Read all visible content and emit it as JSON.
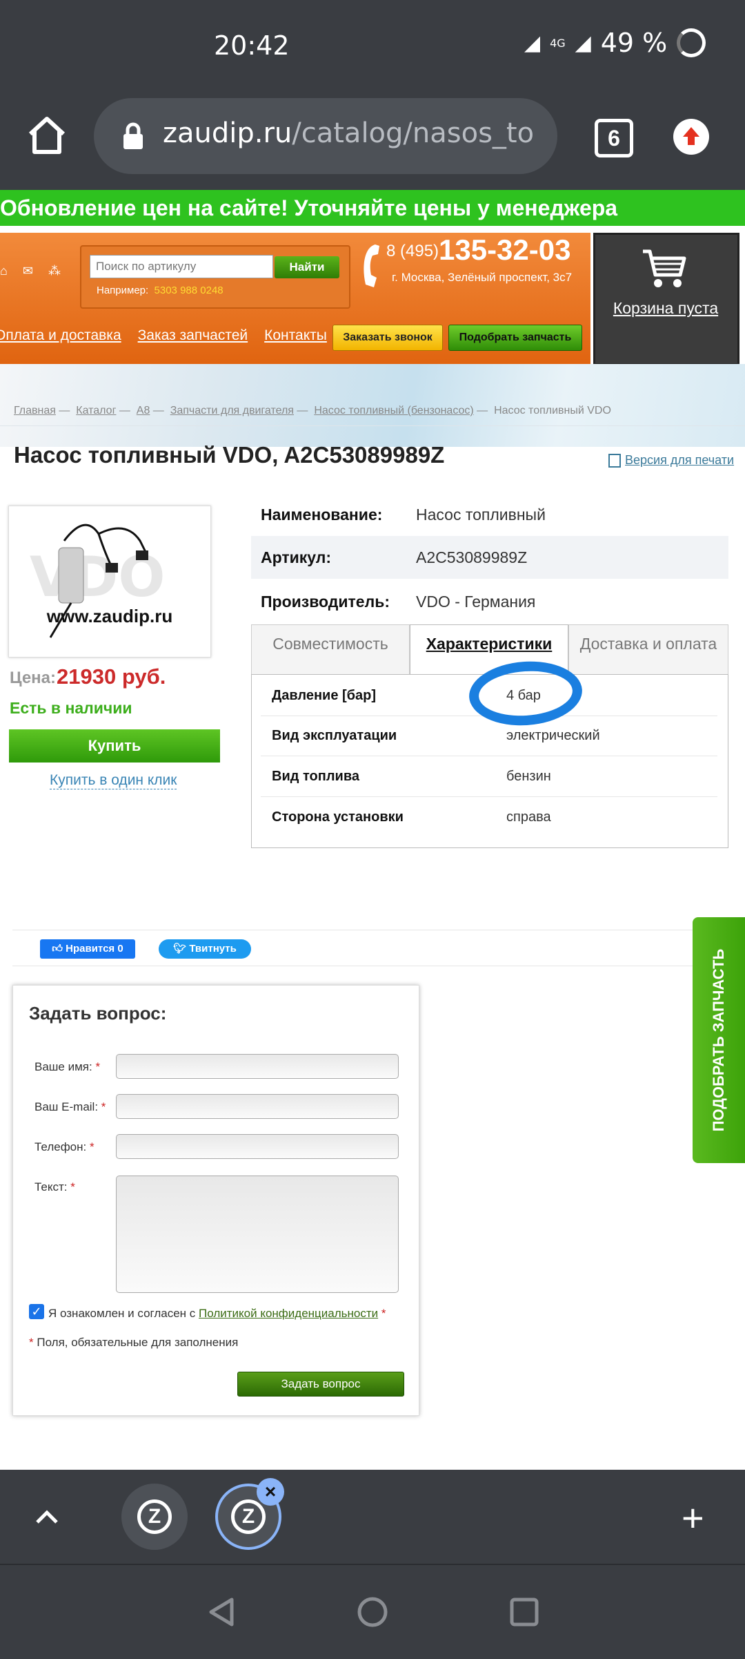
{
  "status": {
    "time": "20:42",
    "network": "4G",
    "battery": "49 %"
  },
  "browser": {
    "url_host": "zaudip.ru",
    "url_path": "/catalog/nasos_to",
    "tab_count": "6"
  },
  "banner": {
    "text": "Обновление цен на сайте! Уточняйте цены у менеджера"
  },
  "header": {
    "search_placeholder": "Поиск по артикулу",
    "search_button": "Найти",
    "example_label": "Например:",
    "example_code": "5303 988 0248",
    "phone_prefix": "8 (495)",
    "phone_number": "135-32-03",
    "address": "г. Москва, Зелёный проспект, 3с7",
    "nav": [
      "Оплата и доставка",
      "Заказ запчастей",
      "Контакты"
    ],
    "callback_button": "Заказать звонок",
    "pick_button": "Подобрать запчасть",
    "cart_label": "Корзина пуста"
  },
  "breadcrumb": [
    "Главная",
    "Каталог",
    "A8",
    "Запчасти для двигателя",
    "Насос топливный (бензонасос)",
    "Насос топливный VDO"
  ],
  "product": {
    "title": "Насос топливный VDO, A2C53089989Z",
    "print_link": "Версия для печати",
    "image_watermark": "www.zaudip.ru",
    "image_logo": "VDO",
    "price_label": "Цена:",
    "price": "21930 руб.",
    "stock": "Есть в наличии",
    "buy_button": "Купить",
    "one_click": "Купить в один клик",
    "specs": [
      {
        "key": "Наименование:",
        "value": "Насос топливный"
      },
      {
        "key": "Артикул:",
        "value": "A2C53089989Z"
      },
      {
        "key": "Производитель:",
        "value": "VDO - Германия"
      }
    ],
    "tabs": [
      "Совместимость",
      "Характеристики",
      "Доставка и оплата"
    ],
    "active_tab": "Характеристики",
    "characteristics": [
      {
        "key": "Давление [бар]",
        "value": "4 бар"
      },
      {
        "key": "Вид эксплуатации",
        "value": "электрический"
      },
      {
        "key": "Вид топлива",
        "value": "бензин"
      },
      {
        "key": "Сторона установки",
        "value": "справа"
      }
    ]
  },
  "social": {
    "like": "Нравится 0",
    "tweet": "Твитнуть"
  },
  "side_tab": "ПОДОБРАТЬ ЗАПЧАСТЬ",
  "form": {
    "title": "Задать вопрос:",
    "name_label": "Ваше имя:",
    "email_label": "Ваш E-mail:",
    "phone_label": "Телефон:",
    "text_label": "Текст:",
    "required_mark": "*",
    "consent_prefix": "Я ознакомлен и согласен с",
    "consent_link": "Политикой конфиденциальности",
    "required_note": "Поля, обязательные для заполнения",
    "submit": "Задать вопрос"
  },
  "colors": {
    "accent_orange": "#e06410",
    "accent_green": "#2ec21f",
    "price_red": "#cc2a2a",
    "annotation_blue": "#1a7fe0"
  }
}
